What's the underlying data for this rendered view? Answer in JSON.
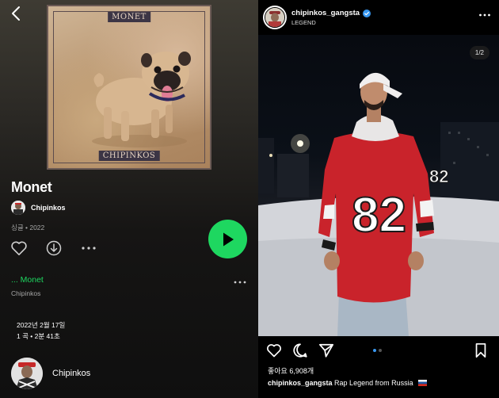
{
  "player": {
    "cover": {
      "top_label": "MONET",
      "bottom_label": "CHIPINKOS"
    },
    "title": "Monet",
    "artist": "Chipinkos",
    "meta": "싱글 • 2022",
    "track": {
      "title": "... Monet",
      "artist": "Chipinkos"
    },
    "release_date": "2022년 2월 17일",
    "release_count": "1 곡 • 2분 41초",
    "artist_card_name": "Chipinkos",
    "accent_color": "#1ed760"
  },
  "instagram": {
    "username": "chipinkos_gangsta",
    "subtitle": "LEGEND",
    "counter": "1/2",
    "jersey_number": "82",
    "likes": "좋아요 6,908개",
    "caption_user": "chipinkos_gangsta",
    "caption_text": "Rap Legend from Russia",
    "dots_active": 1,
    "verified_color": "#3897f0"
  },
  "icons": {
    "back": "chevron-left-icon",
    "heart": "heart-icon",
    "download": "download-icon",
    "more": "more-horizontal-icon",
    "play": "play-icon",
    "comment": "comment-icon",
    "share": "send-icon",
    "save": "bookmark-icon",
    "verified": "verified-badge-icon",
    "flag": "russia-flag-icon"
  }
}
